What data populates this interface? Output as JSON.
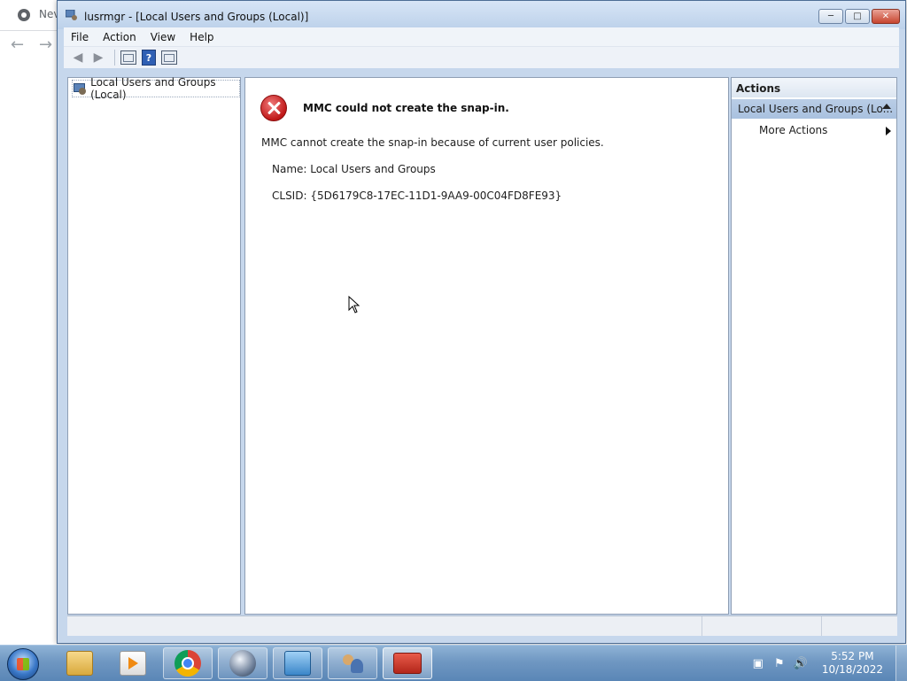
{
  "background_browser": {
    "tab_title": "Nev",
    "back_icon": "arrow-left-icon",
    "forward_icon": "arrow-right-icon"
  },
  "window": {
    "title": "lusrmgr - [Local Users and Groups (Local)]",
    "controls": {
      "minimize": "minimize-icon",
      "maximize": "maximize-icon",
      "close": "close-icon"
    }
  },
  "menubar": {
    "items": [
      {
        "label": "File"
      },
      {
        "label": "Action"
      },
      {
        "label": "View"
      },
      {
        "label": "Help"
      }
    ]
  },
  "toolbar": {
    "buttons": [
      "back-icon",
      "forward-icon",
      "show-hide-console-tree-icon",
      "help-icon",
      "show-hide-action-pane-icon"
    ],
    "help_glyph": "?"
  },
  "tree": {
    "root_label": "Local Users and Groups (Local)"
  },
  "error": {
    "title": "MMC could not create the snap-in.",
    "message": "MMC cannot create the snap-in because of current user policies.",
    "name_line": "Name: Local Users and Groups",
    "clsid_line": "CLSID: {5D6179C8-17EC-11D1-9AA9-00C04FD8FE93}"
  },
  "actions_pane": {
    "header": "Actions",
    "section_title": "Local Users and Groups (Lo...",
    "more_actions": "More Actions"
  },
  "taskbar": {
    "apps": [
      {
        "name": "windows-explorer",
        "icon": "folder-icon"
      },
      {
        "name": "windows-media-player",
        "icon": "media-player-icon"
      },
      {
        "name": "google-chrome",
        "icon": "chrome-icon"
      },
      {
        "name": "sphere-app",
        "icon": "sphere-icon"
      },
      {
        "name": "network-app",
        "icon": "network-icon"
      },
      {
        "name": "users-app",
        "icon": "users-icon"
      },
      {
        "name": "toolbox-app",
        "icon": "toolbox-icon"
      }
    ],
    "clock_time": "5:52 PM",
    "clock_date": "10/18/2022"
  }
}
